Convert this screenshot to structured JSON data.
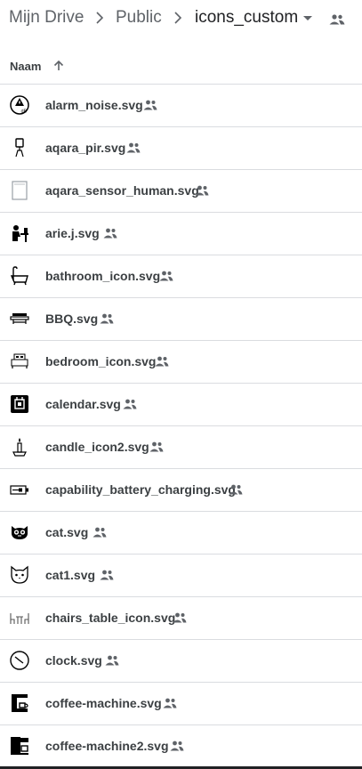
{
  "breadcrumb": {
    "root": "Mijn Drive",
    "parent": "Public",
    "current": "icons_custom"
  },
  "list_header": {
    "name_column": "Naam"
  },
  "files": [
    {
      "name": "alarm_noise.svg",
      "icon": "alarm-noise-icon"
    },
    {
      "name": "aqara_pir.svg",
      "icon": "pir-sensor-icon"
    },
    {
      "name": "aqara_sensor_human.svg",
      "icon": "human-sensor-icon"
    },
    {
      "name": "arie.j.svg",
      "icon": "person-at-desk-icon"
    },
    {
      "name": "bathroom_icon.svg",
      "icon": "bathtub-icon"
    },
    {
      "name": "BBQ.svg",
      "icon": "bbq-grill-icon"
    },
    {
      "name": "bedroom_icon.svg",
      "icon": "bed-icon"
    },
    {
      "name": "calendar.svg",
      "icon": "calendar-icon"
    },
    {
      "name": "candle_icon2.svg",
      "icon": "candle-icon"
    },
    {
      "name": "capability_battery_charging.svg",
      "icon": "battery-charging-icon"
    },
    {
      "name": "cat.svg",
      "icon": "cat-face-icon"
    },
    {
      "name": "cat1.svg",
      "icon": "cat-outline-icon"
    },
    {
      "name": "chairs_table_icon.svg",
      "icon": "chairs-table-icon"
    },
    {
      "name": "clock.svg",
      "icon": "clock-icon"
    },
    {
      "name": "coffee-machine.svg",
      "icon": "coffee-machine-icon"
    },
    {
      "name": "coffee-machine2.svg",
      "icon": "coffee-machine-2-icon"
    }
  ],
  "colors": {
    "text": "#3c4043",
    "muted": "#5f6368",
    "divider": "#dadce0"
  }
}
